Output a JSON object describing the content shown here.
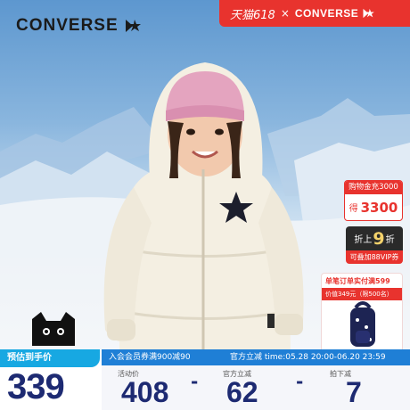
{
  "brand": {
    "name": "CONVERSE",
    "logo_icon": "chevron-star-icon"
  },
  "tmall_banner": {
    "text": "天猫618",
    "separator": "×",
    "brand": "CONVERSE",
    "bg": "#e8332e"
  },
  "promo": {
    "gift": {
      "title": "购物金充3000",
      "prefix": "得",
      "value": "3300"
    },
    "discount": {
      "pre": "折上",
      "num": "9",
      "suf": "折",
      "note": "可叠加88VIP券"
    },
    "coupon": {
      "title": "单笔订单实付满599",
      "subtitle": "价值349元（限500名）"
    }
  },
  "price_bar": {
    "left_tag": "预估到手价",
    "final_price": "339",
    "right_tag_a": "入会会员券满900减90",
    "right_tag_b": "官方立减 time:05.28 20:00-06.20 23:59",
    "cols": [
      {
        "label": "活动价",
        "value": "408"
      },
      {
        "label": "官方立减",
        "value": "62"
      },
      {
        "label": "拍下减",
        "value": "7"
      }
    ],
    "ops": [
      "-",
      "-"
    ]
  },
  "colors": {
    "accent_red": "#e8332e",
    "navy": "#1d2a72",
    "blue_tag": "#17a8e2",
    "blue_bar": "#1f7fd6"
  }
}
